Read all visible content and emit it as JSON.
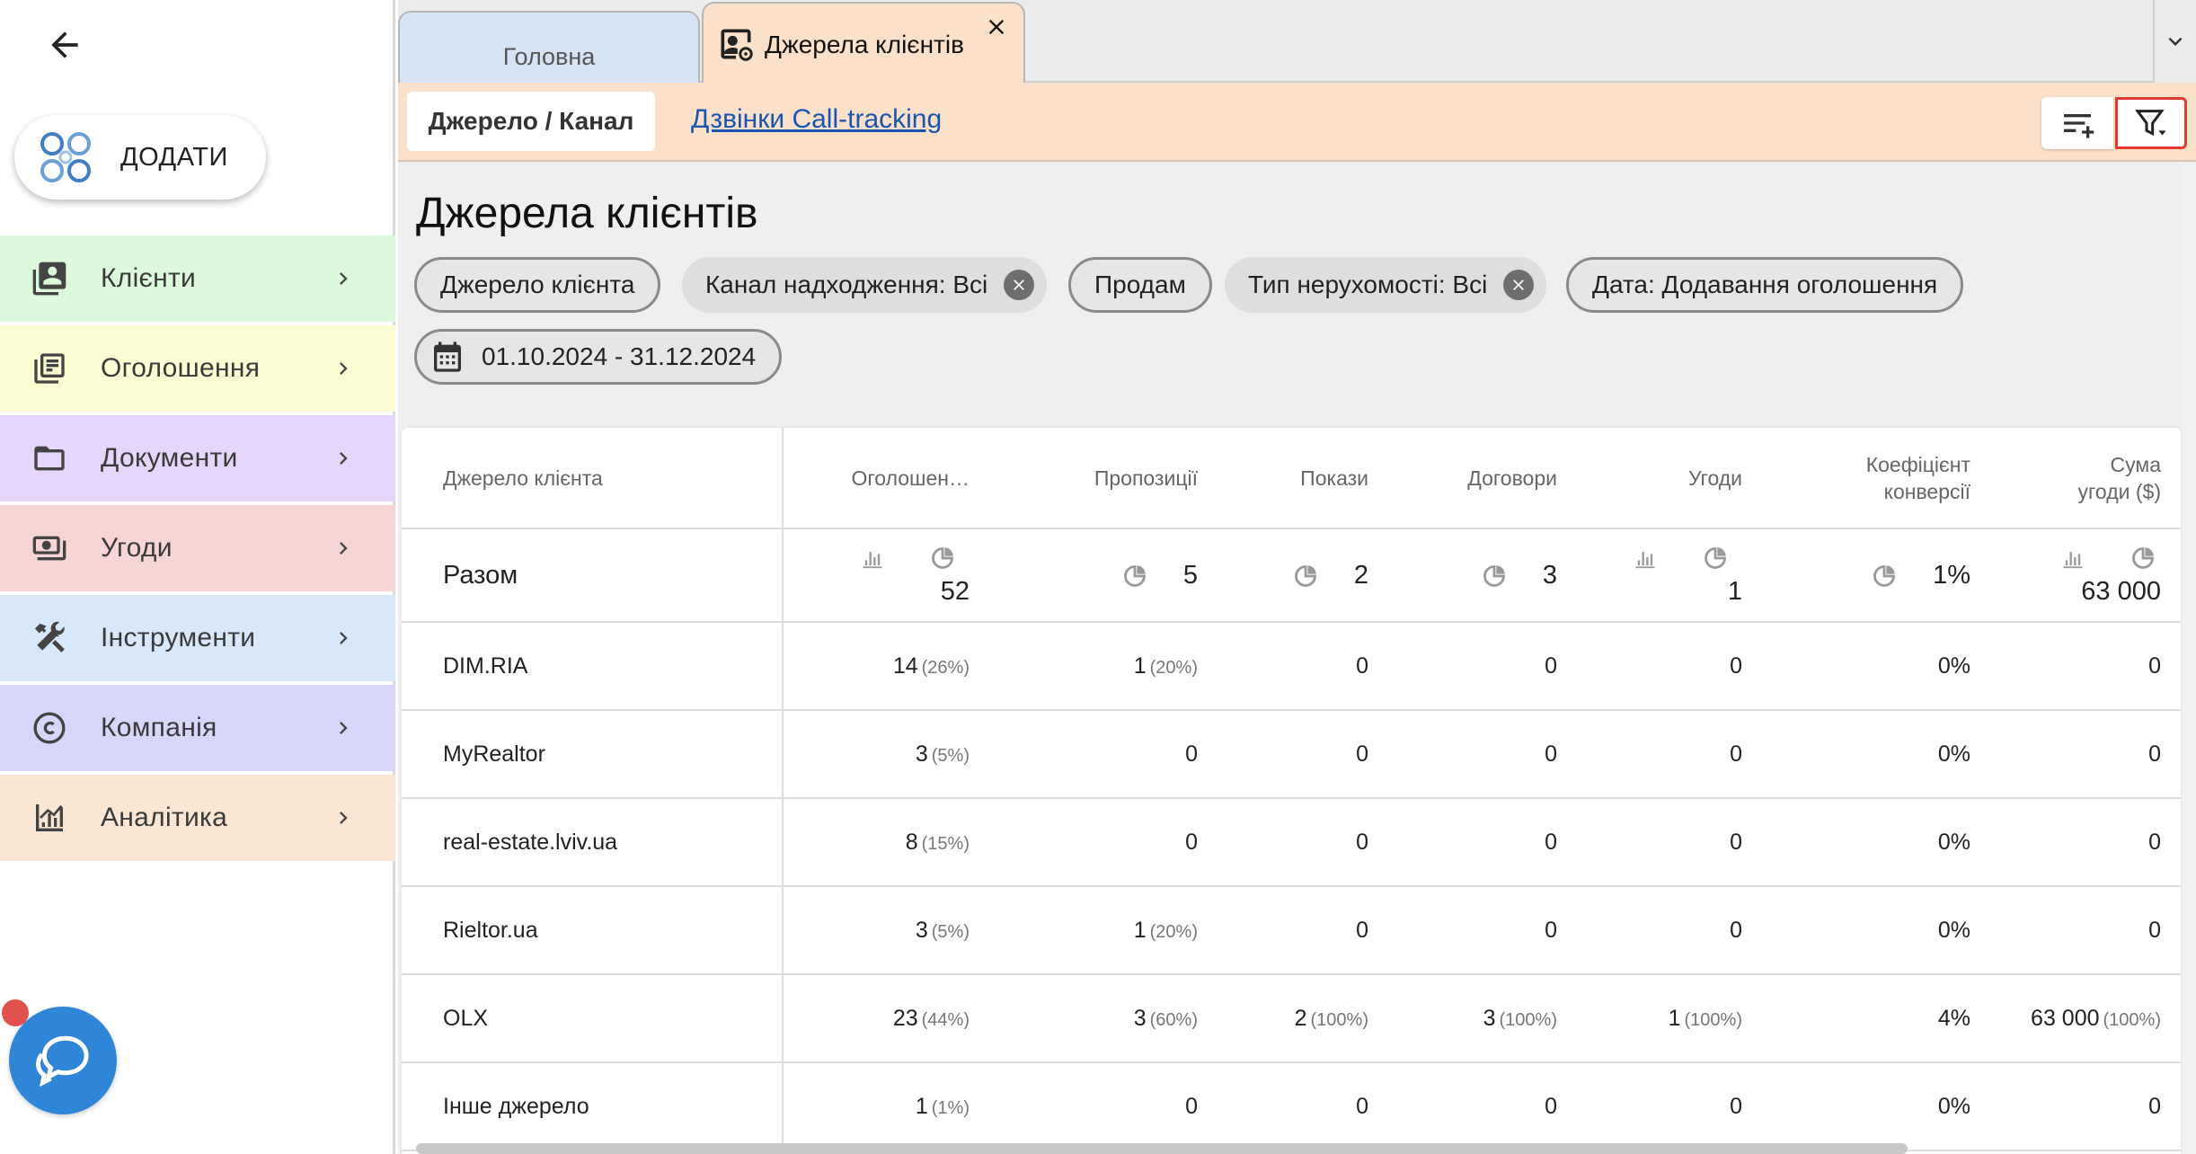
{
  "sidebar": {
    "add_label": "ДОДАТИ",
    "items": [
      {
        "label": "Клієнти",
        "bg": "#dcfadb"
      },
      {
        "label": "Оголошення",
        "bg": "#fdfdd4"
      },
      {
        "label": "Документи",
        "bg": "#e6d6fb"
      },
      {
        "label": "Угоди",
        "bg": "#f8d5d5"
      },
      {
        "label": "Інструменти",
        "bg": "#d8e8fb"
      },
      {
        "label": "Компанія",
        "bg": "#d8d6fb"
      },
      {
        "label": "Аналітика",
        "bg": "#fbe6d4"
      }
    ]
  },
  "tabs": {
    "home": "Головна",
    "sources": "Джерела клієнтів"
  },
  "subnav": {
    "active": "Джерело / Канал",
    "link": "Дзвінки Call-tracking"
  },
  "page": {
    "title": "Джерела клієнтів"
  },
  "filters": {
    "source": "Джерело клієнта",
    "channel": "Канал надходження: Всі",
    "deal": "Продам",
    "type": "Тип нерухомості: Всі",
    "date_kind": "Дата: Додавання оголошення",
    "date_range": "01.10.2024 - 31.12.2024"
  },
  "table": {
    "headers": {
      "source": "Джерело клієнта",
      "listings": "Оголошен…",
      "offers": "Пропозиції",
      "views": "Покази",
      "contracts": "Договори",
      "deals": "Угоди",
      "conv_1": "Коефіцієнт",
      "conv_2": "конверсії",
      "sum_1": "Сума",
      "sum_2": "угоди ($)"
    },
    "total": {
      "label": "Разом",
      "listings": "52",
      "offers": "5",
      "views": "2",
      "contracts": "3",
      "deals": "1",
      "conv": "1%",
      "sum": "63 000"
    },
    "rows": [
      {
        "source": "DIM.RIA",
        "listings": "14",
        "listings_p": "(26%)",
        "offers": "1",
        "offers_p": "(20%)",
        "views": "0",
        "views_p": "",
        "contracts": "0",
        "contracts_p": "",
        "deals": "0",
        "deals_p": "",
        "conv": "0%",
        "sum": "0",
        "sum_p": ""
      },
      {
        "source": "MyRealtor",
        "listings": "3",
        "listings_p": "(5%)",
        "offers": "0",
        "offers_p": "",
        "views": "0",
        "views_p": "",
        "contracts": "0",
        "contracts_p": "",
        "deals": "0",
        "deals_p": "",
        "conv": "0%",
        "sum": "0",
        "sum_p": ""
      },
      {
        "source": "real-estate.lviv.ua",
        "listings": "8",
        "listings_p": "(15%)",
        "offers": "0",
        "offers_p": "",
        "views": "0",
        "views_p": "",
        "contracts": "0",
        "contracts_p": "",
        "deals": "0",
        "deals_p": "",
        "conv": "0%",
        "sum": "0",
        "sum_p": ""
      },
      {
        "source": "Rieltor.ua",
        "listings": "3",
        "listings_p": "(5%)",
        "offers": "1",
        "offers_p": "(20%)",
        "views": "0",
        "views_p": "",
        "contracts": "0",
        "contracts_p": "",
        "deals": "0",
        "deals_p": "",
        "conv": "0%",
        "sum": "0",
        "sum_p": ""
      },
      {
        "source": "OLX",
        "listings": "23",
        "listings_p": "(44%)",
        "offers": "3",
        "offers_p": "(60%)",
        "views": "2",
        "views_p": "(100%)",
        "contracts": "3",
        "contracts_p": "(100%)",
        "deals": "1",
        "deals_p": "(100%)",
        "conv": "4%",
        "sum": "63 000",
        "sum_p": "(100%)"
      },
      {
        "source": "Інше джерело",
        "listings": "1",
        "listings_p": "(1%)",
        "offers": "0",
        "offers_p": "",
        "views": "0",
        "views_p": "",
        "contracts": "0",
        "contracts_p": "",
        "deals": "0",
        "deals_p": "",
        "conv": "0%",
        "sum": "0",
        "sum_p": ""
      }
    ]
  },
  "icons": {
    "back": "arrow-left-icon",
    "add": "network-logo-icon",
    "chat": "chat-bubble-icon",
    "sort": "filter-add-icon",
    "filter": "funnel-dropdown-icon",
    "calendar": "calendar-icon",
    "chart": "bar-chart-icon",
    "pie": "pie-chart-icon"
  },
  "colors": {
    "accent_orange": "#fbe1c9",
    "link_blue": "#1a55b0",
    "filter_highlight": "#e03b2c",
    "chat_blue": "#2f86d9"
  }
}
